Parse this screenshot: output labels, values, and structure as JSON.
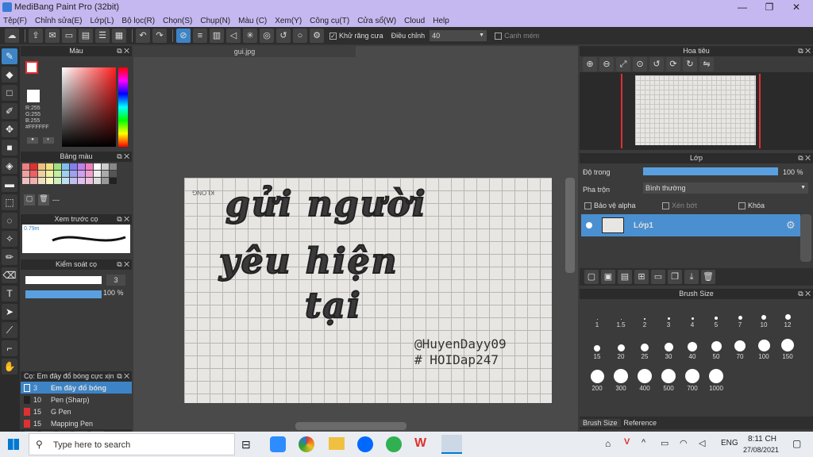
{
  "window": {
    "title": "MediBang Paint Pro (32bit)",
    "minimize": "—",
    "maximize": "❐",
    "close": "✕"
  },
  "menu": [
    "Tệp(F)",
    "Chỉnh sửa(E)",
    "Lớp(L)",
    "Bộ lọc(R)",
    "Chọn(S)",
    "Chụp(N)",
    "Màu (C)",
    "Xem(Y)",
    "Công cụ(T)",
    "Cửa sổ(W)",
    "Cloud",
    "Help"
  ],
  "toolbar": {
    "antialias_label": "Khử răng cưa",
    "adjust_label": "Điều chỉnh",
    "adjust_value": "40",
    "edge_label": "Canh mém"
  },
  "color_panel": {
    "title": "Màu",
    "r": "R:255",
    "g": "G:255",
    "b": "B:255",
    "hex": "#FFFFFF"
  },
  "palette_panel": {
    "title": "Bảng màu",
    "name": "---"
  },
  "preview_panel": {
    "title": "Xem trước cọ",
    "size": "0.79m"
  },
  "brush_control": {
    "title": "Kiểm soát cọ",
    "size": "3",
    "opacity": "100 %"
  },
  "brush_list": {
    "title": "Cọ: Em đây đổ bóng cực xịn",
    "items": [
      {
        "size": "3",
        "name": "Em đây đổ bóng",
        "color": "#3d84c6",
        "selected": true
      },
      {
        "size": "10",
        "name": "Pen (Sharp)",
        "color": "#222222",
        "selected": false
      },
      {
        "size": "15",
        "name": "G Pen",
        "color": "#e03030",
        "selected": false
      },
      {
        "size": "15",
        "name": "Mapping Pen",
        "color": "#e03030",
        "selected": false
      }
    ]
  },
  "document": {
    "tab": "gui.jpg",
    "lines": [
      "gửi người",
      "yêu hiện",
      "tại"
    ],
    "signature1": "@HuyenDayy09",
    "signature2": "# HOIDap247",
    "brand": "KLONG"
  },
  "navigator": {
    "title": "Hoa tiêu"
  },
  "layer_panel": {
    "title": "Lớp",
    "opacity_label": "Độ trong",
    "opacity_value": "100 %",
    "blend_label": "Pha trộn",
    "blend_value": "Bình thường",
    "protect_alpha": "Bảo vệ alpha",
    "clip": "Xén bớt",
    "lock": "Khóa",
    "layer_name": "Lớp1"
  },
  "brush_size": {
    "title": "Brush Size",
    "sizes": [
      "1",
      "1.5",
      "2",
      "3",
      "4",
      "5",
      "7",
      "10",
      "12",
      "15",
      "20",
      "25",
      "30",
      "40",
      "50",
      "70",
      "100",
      "150",
      "200",
      "300",
      "400",
      "500",
      "700",
      "1000"
    ],
    "tab1": "Brush Size",
    "tab2": "Reference"
  },
  "taskbar": {
    "search": "Type here to search",
    "lang": "ENG",
    "time": "8:11 CH",
    "date": "27/08/2021"
  }
}
